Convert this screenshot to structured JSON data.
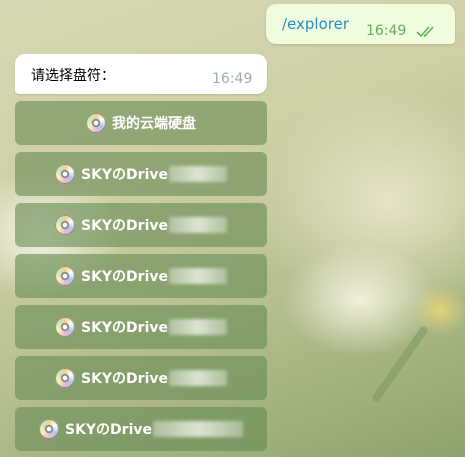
{
  "outgoing_message": {
    "text": "/explorer",
    "time": "16:49",
    "status_icon": "double-check-icon"
  },
  "incoming_message": {
    "text": "请选择盘符：",
    "time": "16:49"
  },
  "keyboard": {
    "icon": "cd-disc-icon",
    "buttons": [
      {
        "label": "我的云端硬盘"
      },
      {
        "label": "SKYのDrive"
      },
      {
        "label": "SKYのDrive"
      },
      {
        "label": "SKYのDrive"
      },
      {
        "label": "SKYのDrive"
      },
      {
        "label": "SKYのDrive"
      },
      {
        "label": "SKYのDrive"
      }
    ]
  },
  "colors": {
    "outgoing_bubble": "#effdde",
    "incoming_bubble": "#ffffff",
    "command_link": "#2a8fc4",
    "button_bg": "#698c55"
  }
}
